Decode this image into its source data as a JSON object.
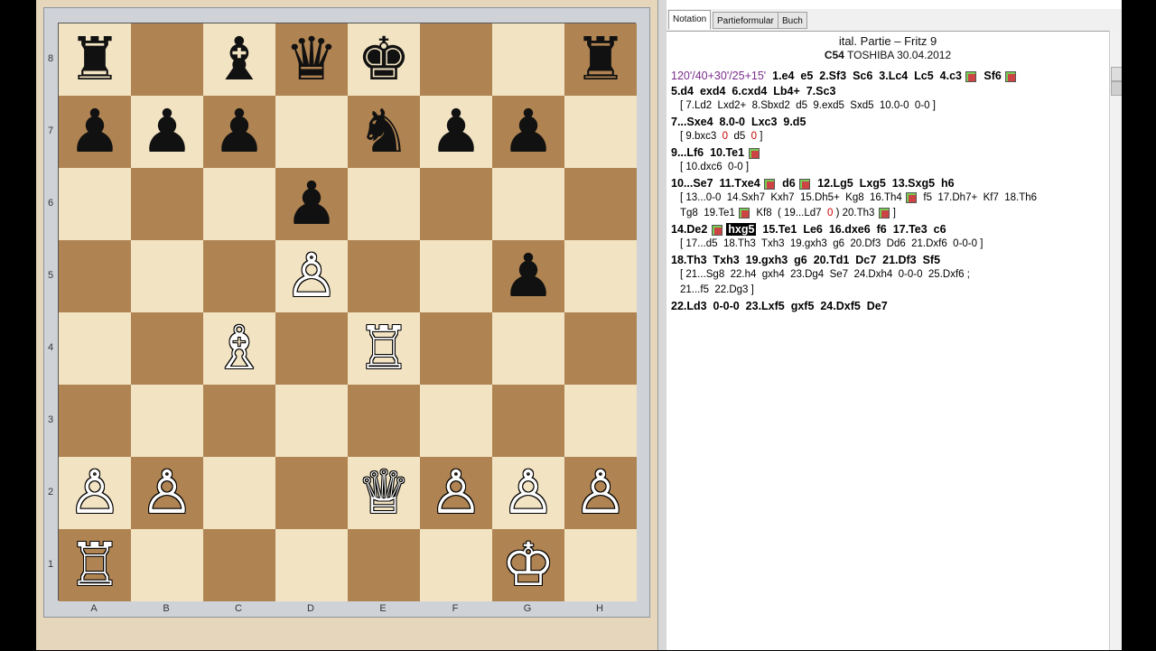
{
  "board": {
    "files": [
      "A",
      "B",
      "C",
      "D",
      "E",
      "F",
      "G",
      "H"
    ],
    "ranks": [
      "8",
      "7",
      "6",
      "5",
      "4",
      "3",
      "2",
      "1"
    ],
    "pieces": [
      {
        "sq": "a8",
        "glyph": "♜",
        "color": "b",
        "name": "black-rook"
      },
      {
        "sq": "c8",
        "glyph": "♝",
        "color": "b",
        "name": "black-bishop"
      },
      {
        "sq": "d8",
        "glyph": "♛",
        "color": "b",
        "name": "black-queen"
      },
      {
        "sq": "e8",
        "glyph": "♚",
        "color": "b",
        "name": "black-king"
      },
      {
        "sq": "h8",
        "glyph": "♜",
        "color": "b",
        "name": "black-rook"
      },
      {
        "sq": "a7",
        "glyph": "♟",
        "color": "b",
        "name": "black-pawn"
      },
      {
        "sq": "b7",
        "glyph": "♟",
        "color": "b",
        "name": "black-pawn"
      },
      {
        "sq": "c7",
        "glyph": "♟",
        "color": "b",
        "name": "black-pawn"
      },
      {
        "sq": "e7",
        "glyph": "♞",
        "color": "b",
        "name": "black-knight"
      },
      {
        "sq": "f7",
        "glyph": "♟",
        "color": "b",
        "name": "black-pawn"
      },
      {
        "sq": "g7",
        "glyph": "♟",
        "color": "b",
        "name": "black-pawn"
      },
      {
        "sq": "d6",
        "glyph": "♟",
        "color": "b",
        "name": "black-pawn"
      },
      {
        "sq": "d5",
        "glyph": "♙",
        "color": "w",
        "name": "white-pawn"
      },
      {
        "sq": "g5",
        "glyph": "♟",
        "color": "b",
        "name": "black-pawn"
      },
      {
        "sq": "c4",
        "glyph": "♗",
        "color": "w",
        "name": "white-bishop"
      },
      {
        "sq": "e4",
        "glyph": "♖",
        "color": "w",
        "name": "white-rook"
      },
      {
        "sq": "a2",
        "glyph": "♙",
        "color": "w",
        "name": "white-pawn"
      },
      {
        "sq": "b2",
        "glyph": "♙",
        "color": "w",
        "name": "white-pawn"
      },
      {
        "sq": "e2",
        "glyph": "♕",
        "color": "w",
        "name": "white-queen"
      },
      {
        "sq": "f2",
        "glyph": "♙",
        "color": "w",
        "name": "white-pawn"
      },
      {
        "sq": "g2",
        "glyph": "♙",
        "color": "w",
        "name": "white-pawn"
      },
      {
        "sq": "h2",
        "glyph": "♙",
        "color": "w",
        "name": "white-pawn"
      },
      {
        "sq": "a1",
        "glyph": "♖",
        "color": "w",
        "name": "white-rook"
      },
      {
        "sq": "g1",
        "glyph": "♔",
        "color": "w",
        "name": "white-king"
      }
    ]
  },
  "tabs": [
    "Notation",
    "Partieformular",
    "Buch"
  ],
  "game": {
    "title": "ital. Partie – Fritz 9",
    "eco": "C54",
    "info": "TOSHIBA 30.04.2012"
  },
  "notation": [
    {
      "type": "main",
      "segments": [
        {
          "t": "120'/40+30'/25+15'",
          "c": "tc"
        },
        {
          "t": "  1.e4  e5  2.Sf3  Sc6  3.Lc4  Lc5  4.c3 "
        },
        {
          "box": true
        },
        {
          "t": "  Sf6 "
        },
        {
          "box": true
        }
      ]
    },
    {
      "type": "main",
      "segments": [
        {
          "t": "5.d4  exd4  6.cxd4  Lb4+  7.Sc3"
        }
      ]
    },
    {
      "type": "var",
      "segments": [
        {
          "t": "[ 7.Ld2  Lxd2+  8.Sbxd2  d5  9.exd5  Sxd5  10.0-0  0-0 ]"
        }
      ]
    },
    {
      "type": "main",
      "segments": [
        {
          "t": "7...Sxe4  8.0-0  Lxc3  9.d5"
        }
      ]
    },
    {
      "type": "var",
      "segments": [
        {
          "t": "[ 9.bxc3  "
        },
        {
          "t": "0",
          "c": "zero"
        },
        {
          "t": "  d5  "
        },
        {
          "t": "0",
          "c": "zero"
        },
        {
          "t": " ]"
        }
      ]
    },
    {
      "type": "main",
      "segments": [
        {
          "t": "9...Lf6  10.Te1 "
        },
        {
          "box": true
        }
      ]
    },
    {
      "type": "var",
      "segments": [
        {
          "t": "[ 10.dxc6  0-0 ]"
        }
      ]
    },
    {
      "type": "main",
      "segments": [
        {
          "t": "10...Se7  11.Txe4 "
        },
        {
          "box": true
        },
        {
          "t": "  d6 "
        },
        {
          "box": true
        },
        {
          "t": "  12.Lg5  Lxg5  13.Sxg5  h6"
        }
      ]
    },
    {
      "type": "var",
      "segments": [
        {
          "t": "[ 13...0-0  14.Sxh7  Kxh7  15.Dh5+  Kg8  16.Th4 "
        },
        {
          "box": true
        },
        {
          "t": "  f5  17.Dh7+  Kf7  18.Th6"
        }
      ]
    },
    {
      "type": "var",
      "segments": [
        {
          "t": "Tg8  19.Te1 "
        },
        {
          "box": true
        },
        {
          "t": "  Kf8  ( 19...Ld7  "
        },
        {
          "t": "0",
          "c": "zero"
        },
        {
          "t": " ) 20.Th3 "
        },
        {
          "box": true
        },
        {
          "t": " ]"
        }
      ]
    },
    {
      "type": "main",
      "segments": [
        {
          "t": "14.De2 "
        },
        {
          "box": true
        },
        {
          "t": " "
        },
        {
          "t": "hxg5",
          "c": "hl"
        },
        {
          "t": "  15.Te1  Le6  16.dxe6  f6  17.Te3  c6"
        }
      ]
    },
    {
      "type": "var",
      "segments": [
        {
          "t": "[ 17...d5  18.Th3  Txh3  19.gxh3  g6  20.Df3  Dd6  21.Dxf6  0-0-0 ]"
        }
      ]
    },
    {
      "type": "main",
      "segments": [
        {
          "t": "18.Th3  Txh3  19.gxh3  g6  20.Td1  Dc7  21.Df3  Sf5"
        }
      ]
    },
    {
      "type": "var",
      "segments": [
        {
          "t": "[ 21...Sg8  22.h4  gxh4  23.Dg4  Se7  24.Dxh4  0-0-0  25.Dxf6 ;"
        }
      ]
    },
    {
      "type": "var",
      "segments": [
        {
          "t": "21...f5  22.Dg3 ]"
        }
      ]
    },
    {
      "type": "main",
      "segments": [
        {
          "t": "22.Ld3  0-0-0  23.Lxf5  gxf5  24.Dxf5  De7"
        }
      ]
    }
  ]
}
